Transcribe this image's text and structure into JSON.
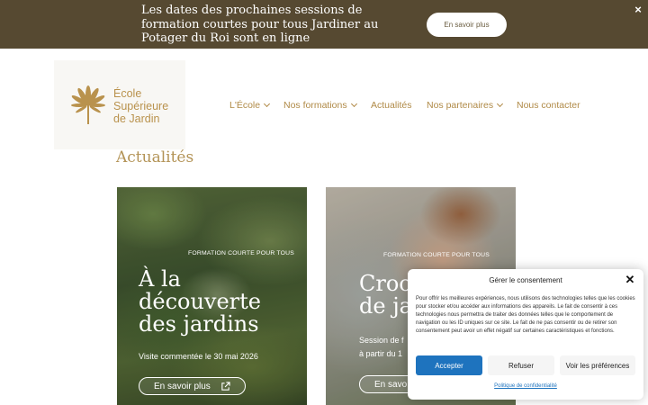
{
  "announcement": {
    "text": "Les dates des prochaines sessions de formation courtes pour tous Jardiner au Potager du Roi sont en ligne",
    "button_label": "En savoir plus",
    "close_glyph": "×",
    "background": "#564931"
  },
  "logo": {
    "line1": "École",
    "line2": "Supérieure",
    "line3": "de Jardin",
    "color": "#b9924d"
  },
  "nav": {
    "items": [
      {
        "label": "L'École",
        "has_dropdown": true
      },
      {
        "label": "Nos formations",
        "has_dropdown": true
      },
      {
        "label": "Actualités",
        "has_dropdown": false
      },
      {
        "label": "Nos partenaires",
        "has_dropdown": true
      },
      {
        "label": "Nous contacter",
        "has_dropdown": false
      }
    ]
  },
  "page": {
    "title": "Actualités"
  },
  "cards": [
    {
      "tag": "FORMATION COURTE POUR TOUS",
      "title_lines": [
        "À la",
        "découverte",
        "des jardins"
      ],
      "subtitle": "Visite commentée le 30 mai 2026",
      "button_label": "En savoir plus"
    },
    {
      "tag": "FORMATION COURTE POUR TOUS",
      "title_lines": [
        "Croo",
        "de ja"
      ],
      "subtitle_lines": [
        "Session de f",
        "à partir du 1"
      ],
      "button_label": "En savo"
    }
  ],
  "consent": {
    "title": "Gérer le consentement",
    "text": "Pour offrir les meilleures expériences, nous utilisons des technologies telles que les cookies pour stocker et/ou accéder aux informations des appareils. Le fait de consentir à ces technologies nous permettra de traiter des données telles que le comportement de navigation ou les ID uniques sur ce site. Le fait de ne pas consentir ou de retirer son consentement peut avoir un effet négatif sur certaines caractéristiques et fonctions.",
    "accept_label": "Accepter",
    "refuse_label": "Refuser",
    "prefs_label": "Voir les préférences",
    "policy_link": "Politique de confidentialité",
    "accent": "#1e73be"
  }
}
